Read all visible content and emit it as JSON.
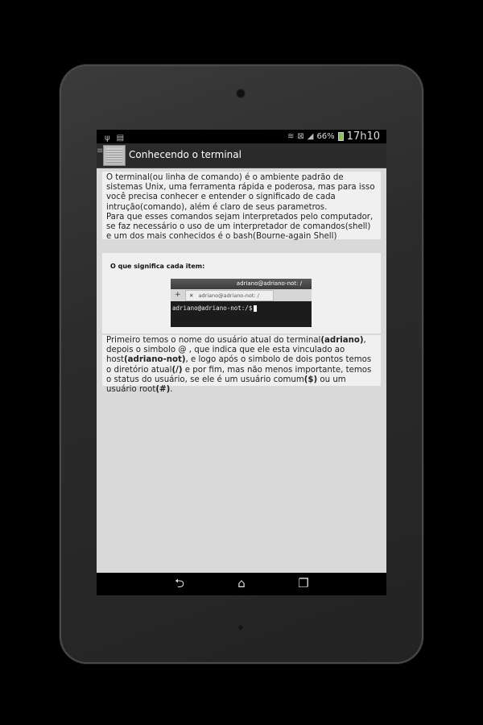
{
  "status_bar": {
    "left_icons": [
      "usb-icon",
      "sd-card-icon"
    ],
    "right_icons": [
      "vibrate-icon",
      "no-signal-icon",
      "signal-icon"
    ],
    "battery_percent": "66%",
    "time": "17h10"
  },
  "action_bar": {
    "title": "Conhecendo o terminal"
  },
  "content": {
    "intro_paragraph": "O terminal(ou linha de comando) é o ambiente padrão de sistemas Unix, uma ferramenta rápida e poderosa, mas para isso você precisa conhecer e entender o significado de cada intrução(comando), além é claro de seus parametros.",
    "intro_paragraph_2": "Para que esses comandos sejam interpretados pelo computador, se faz necessário o uso de um interpretador de comandos(shell) e um dos mais conhecidos é o bash(Bourne-again Shell)",
    "image_label": "O que significa cada item:",
    "terminal_title": "adriano@adriano-not: /",
    "terminal_tab": "adriano@adriano-not: /",
    "terminal_prompt": "adriano@adriano-not:/$",
    "explain": {
      "t1": "Primeiro temos o nome do usuário atual do terminal",
      "b1": "(adriano)",
      "t2": ", depois o simbolo @ , que indica que ele esta vinculado ao host",
      "b2": "(adriano-not)",
      "t3": ", e logo após o simbolo de dois pontos temos o diretório atual",
      "b3": "(/)",
      "t4": " e por fim, mas não menos importante, temos o status do usuário, se ele é um usuário comum",
      "b4": "($)",
      "t5": " ou um usuário root",
      "b5": "(#)",
      "t6": "."
    }
  },
  "nav_bar": {
    "buttons": [
      "back-icon",
      "home-icon",
      "recent-apps-icon"
    ]
  }
}
